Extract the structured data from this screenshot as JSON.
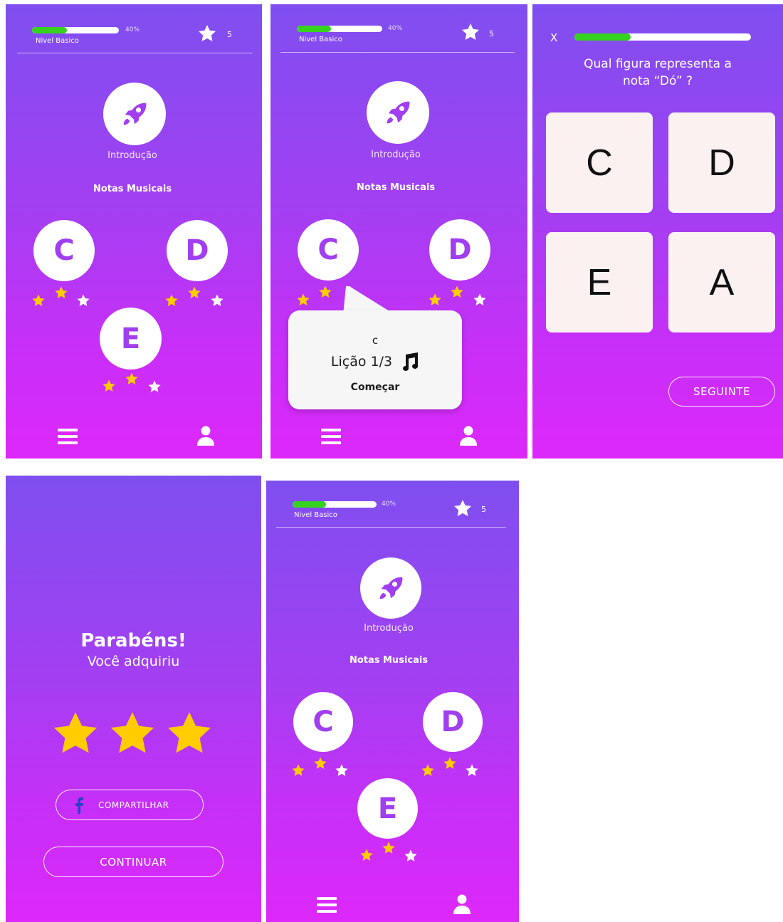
{
  "header": {
    "progress_percent": 40,
    "progress_label": "40%",
    "level_label": "Nivel Basico",
    "star_count": "5"
  },
  "home": {
    "intro_label": "Introdução",
    "section_title": "Notas Musicais",
    "lessons": [
      {
        "letter": "C",
        "stars_earned": 2,
        "stars_total": 3
      },
      {
        "letter": "D",
        "stars_earned": 2,
        "stars_total": 3
      },
      {
        "letter": "E",
        "stars_earned": 2,
        "stars_total": 3
      }
    ]
  },
  "popup": {
    "lesson_letter": "c",
    "lesson_progress": "Lição 1/3",
    "start_label": "Começar"
  },
  "quiz": {
    "close_label": "X",
    "progress_fraction": 0.32,
    "question_line1": "Qual figura representa a",
    "question_line2": "nota  “Dó” ?",
    "options": [
      "C",
      "D",
      "E",
      "A"
    ],
    "next_label": "SEGUINTE"
  },
  "congrats": {
    "title": "Parabéns!",
    "subtitle": "Você adquiriu",
    "stars_earned": 3,
    "share_label": "COMPARTILHAR",
    "continue_label": "CONTINUAR"
  },
  "colors": {
    "gradient_top": "#7f4ff0",
    "gradient_bottom": "#dd28fb",
    "progress_green": "#37d21f",
    "star_gold": "#ffcc00",
    "letter_purple": "#a03ef0",
    "tile_bg": "#fbf1f1"
  },
  "icons": {
    "intro": "rocket-icon",
    "menu": "hamburger-menu-icon",
    "profile": "user-profile-icon",
    "lesson": "music-note-icon",
    "share": "facebook-icon"
  }
}
